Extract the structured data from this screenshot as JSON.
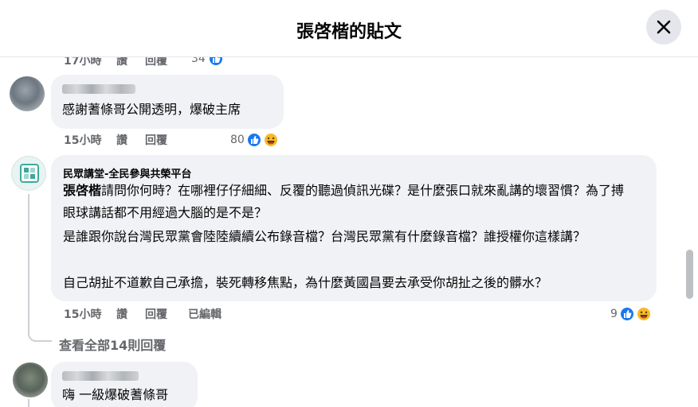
{
  "header": {
    "title": "張啓楷的貼文"
  },
  "comments": [
    {
      "time": "17小時",
      "read": "讚",
      "reply": "回覆",
      "reactions": "34"
    },
    {
      "text": "感謝蓍條哥公開透明，爆破主席",
      "time": "15小時",
      "read": "讚",
      "reply": "回覆",
      "reactions": "80"
    },
    {
      "author": "民眾講堂-全民參與共榮平台",
      "mention": "張啓楷",
      "paragraph1_rest": "請問你何時？在哪裡仔仔細細、反覆的聽過偵訊光碟？是什麼張口就來亂講的壞習慣？為了搏眼球講話都不用經過大腦的是不是？",
      "paragraph2": "是誰跟你說台灣民眾黨會陸陸續續公布錄音檔？台灣民眾黨有什麼錄音檔？誰授權你這樣講？",
      "paragraph3": "自己胡扯不道歉自己承擔，裝死轉移焦點，為什麼黃國昌要去承受你胡扯之後的髒水？",
      "time": "15小時",
      "read": "讚",
      "reply": "回覆",
      "edited": "已編輯",
      "reactions": "9",
      "view_replies": "查看全部14則回覆"
    },
    {
      "text": "嗨 一級爆破蓍條哥"
    }
  ],
  "colors": {
    "like": "#1877f2",
    "haha": "#f7b928",
    "bubble": "#f0f2f5",
    "meta": "#65676b"
  }
}
